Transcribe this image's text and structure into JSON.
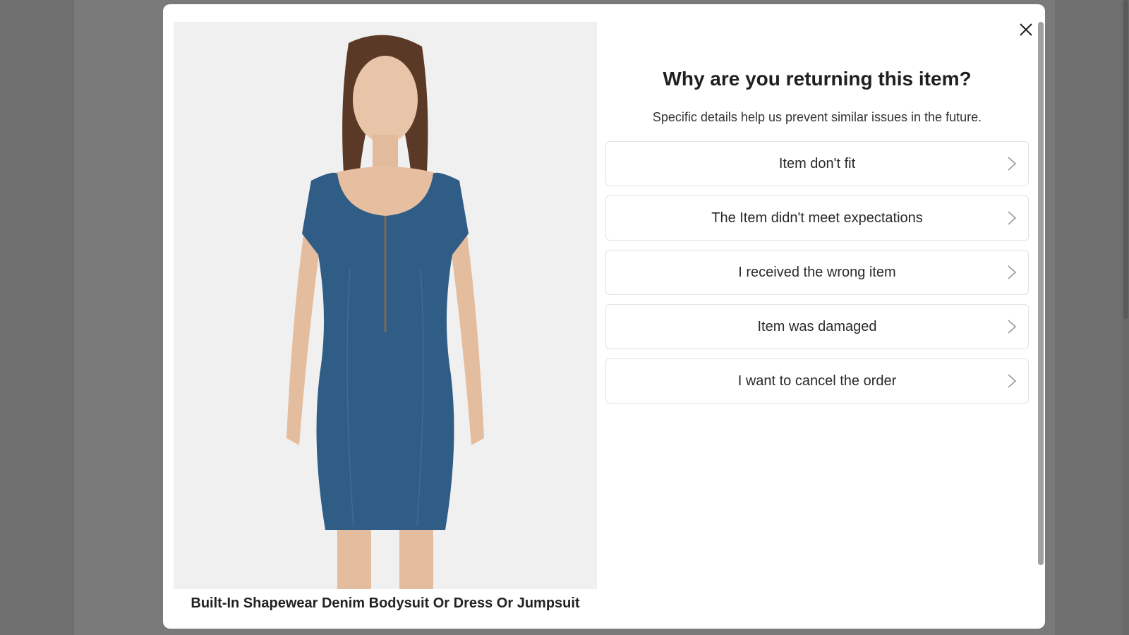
{
  "modal": {
    "title": "Why are you returning this item?",
    "subtitle": "Specific details help us prevent similar issues in the future.",
    "close_icon": "close-icon",
    "reasons": [
      {
        "label": "Item don't fit",
        "icon": "chevron-right-icon"
      },
      {
        "label": "The Item didn't meet expectations",
        "icon": "chevron-right-icon"
      },
      {
        "label": "I received the wrong item",
        "icon": "chevron-right-icon"
      },
      {
        "label": "Item was damaged",
        "icon": "chevron-right-icon"
      },
      {
        "label": "I want to cancel the order",
        "icon": "chevron-right-icon"
      }
    ]
  },
  "product": {
    "name": "Built-In Shapewear Denim Bodysuit Or Dress Or Jumpsuit",
    "image": "model wearing blue denim short-sleeve zip-front dress"
  },
  "colors": {
    "overlay": "#6f6f6f",
    "modal_bg": "#ffffff",
    "dress": "#2f5d86",
    "border": "#e3e3e3"
  }
}
